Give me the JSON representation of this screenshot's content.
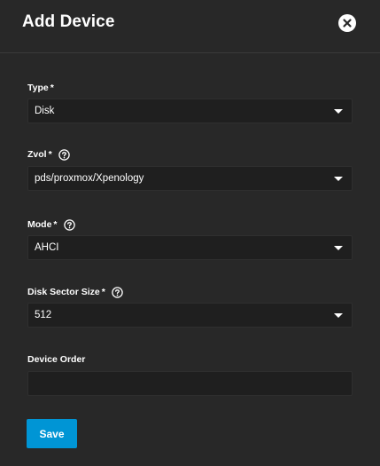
{
  "dialog": {
    "title": "Add Device",
    "close_icon": "close-circle-icon"
  },
  "fields": {
    "type": {
      "label": "Type",
      "required_mark": "*",
      "value": "Disk"
    },
    "zvol": {
      "label": "Zvol",
      "required_mark": "*",
      "help_icon": "help-circle-icon",
      "value": "pds/proxmox/Xpenology"
    },
    "mode": {
      "label": "Mode",
      "required_mark": "*",
      "help_icon": "help-circle-icon",
      "value": "AHCI"
    },
    "disk_sector_size": {
      "label": "Disk Sector Size",
      "required_mark": "*",
      "help_icon": "help-circle-icon",
      "value": "512"
    },
    "device_order": {
      "label": "Device Order",
      "value": ""
    }
  },
  "actions": {
    "save_label": "Save"
  },
  "colors": {
    "background": "#282828",
    "input_background": "#1f1f1f",
    "accent": "#0095d5",
    "text": "#ffffff"
  }
}
